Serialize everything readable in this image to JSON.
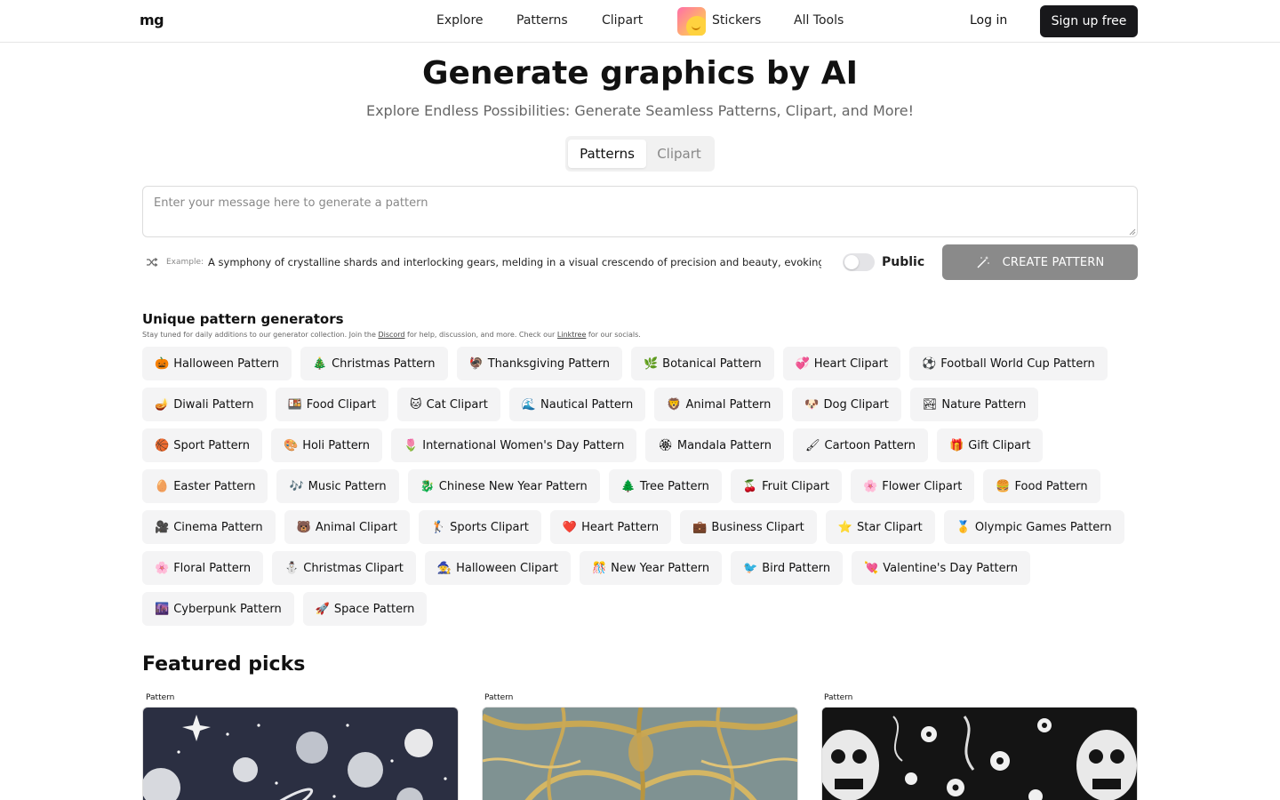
{
  "header": {
    "logo": "mg",
    "nav": [
      "Explore",
      "Patterns",
      "Clipart",
      "Stickers",
      "All Tools"
    ],
    "login": "Log in",
    "signup": "Sign up free"
  },
  "hero": {
    "title": "Generate graphics by AI",
    "subtitle": "Explore Endless Possibilities: Generate Seamless Patterns, Clipart, and More!",
    "tabs": [
      "Patterns",
      "Clipart"
    ],
    "active_tab": "Patterns",
    "prompt_placeholder": "Enter your message here to generate a pattern",
    "example_label": "Example:",
    "example_text": "A symphony of crystalline shards and interlocking gears, melding in a visual crescendo of precision and beauty, evoking the hear",
    "public_label": "Public",
    "create_label": "CREATE PATTERN"
  },
  "generators": {
    "title": "Unique pattern generators",
    "note_before": "Stay tuned for daily additions to our generator collection. Join the ",
    "note_link1": "Discord",
    "note_middle": " for help, discussion, and more. Check our ",
    "note_link2": "Linktree",
    "note_after": " for our socials.",
    "chips": [
      {
        "icon": "🎃",
        "label": "Halloween Pattern"
      },
      {
        "icon": "🎄",
        "label": "Christmas Pattern"
      },
      {
        "icon": "🦃",
        "label": "Thanksgiving Pattern"
      },
      {
        "icon": "🌿",
        "label": "Botanical Pattern"
      },
      {
        "icon": "💞",
        "label": "Heart Clipart"
      },
      {
        "icon": "⚽",
        "label": "Football World Cup Pattern"
      },
      {
        "icon": "🪔",
        "label": "Diwali Pattern"
      },
      {
        "icon": "🍱",
        "label": "Food Clipart"
      },
      {
        "icon": "🐱",
        "label": "Cat Clipart"
      },
      {
        "icon": "🌊",
        "label": "Nautical Pattern"
      },
      {
        "icon": "🦁",
        "label": "Animal Pattern"
      },
      {
        "icon": "🐶",
        "label": "Dog Clipart"
      },
      {
        "icon": "🏞",
        "label": "Nature Pattern"
      },
      {
        "icon": "🏀",
        "label": "Sport Pattern"
      },
      {
        "icon": "🎨",
        "label": "Holi Pattern"
      },
      {
        "icon": "🌷",
        "label": "International Women's Day Pattern"
      },
      {
        "icon": "🏵",
        "label": "Mandala Pattern"
      },
      {
        "icon": "🖌",
        "label": "Cartoon Pattern"
      },
      {
        "icon": "🎁",
        "label": "Gift Clipart"
      },
      {
        "icon": "🥚",
        "label": "Easter Pattern"
      },
      {
        "icon": "🎶",
        "label": "Music Pattern"
      },
      {
        "icon": "🐉",
        "label": "Chinese New Year Pattern"
      },
      {
        "icon": "🌲",
        "label": "Tree Pattern"
      },
      {
        "icon": "🍒",
        "label": "Fruit Clipart"
      },
      {
        "icon": "🌸",
        "label": "Flower Clipart"
      },
      {
        "icon": "🍔",
        "label": "Food Pattern"
      },
      {
        "icon": "🎥",
        "label": "Cinema Pattern"
      },
      {
        "icon": "🐻",
        "label": "Animal Clipart"
      },
      {
        "icon": "🏌",
        "label": "Sports Clipart"
      },
      {
        "icon": "❤️",
        "label": "Heart Pattern"
      },
      {
        "icon": "💼",
        "label": "Business Clipart"
      },
      {
        "icon": "⭐",
        "label": "Star Clipart"
      },
      {
        "icon": "🥇",
        "label": "Olympic Games Pattern"
      },
      {
        "icon": "🌸",
        "label": "Floral Pattern"
      },
      {
        "icon": "⛄",
        "label": "Christmas Clipart"
      },
      {
        "icon": "🧙",
        "label": "Halloween Clipart"
      },
      {
        "icon": "🎊",
        "label": "New Year Pattern"
      },
      {
        "icon": "🐦",
        "label": "Bird Pattern"
      },
      {
        "icon": "💘",
        "label": "Valentine's Day Pattern"
      },
      {
        "icon": "🌆",
        "label": "Cyberpunk Pattern"
      },
      {
        "icon": "🚀",
        "label": "Space Pattern"
      }
    ]
  },
  "featured": {
    "title": "Featured picks",
    "cards": [
      {
        "label": "Pattern"
      },
      {
        "label": "Pattern"
      },
      {
        "label": "Pattern"
      }
    ]
  }
}
